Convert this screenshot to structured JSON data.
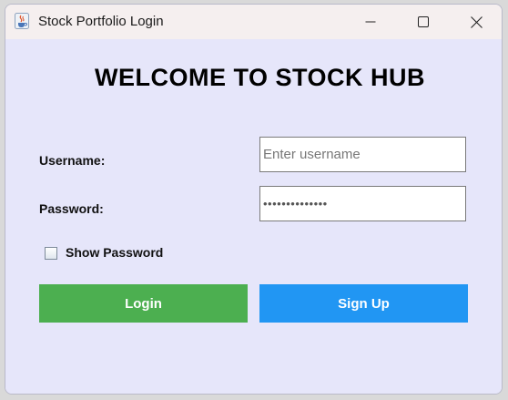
{
  "window": {
    "title": "Stock Portfolio Login",
    "icon": "java-cup-icon",
    "controls": [
      "minimize-icon",
      "maximize-icon",
      "close-icon"
    ]
  },
  "heading": "WELCOME TO STOCK HUB",
  "form": {
    "username_label": "Username:",
    "username_placeholder": "Enter username",
    "username_value": "",
    "password_label": "Password:",
    "password_value": "••••••••••••••",
    "show_password_label": "Show Password",
    "show_password_checked": false
  },
  "buttons": {
    "login": "Login",
    "signup": "Sign Up"
  },
  "colors": {
    "background": "#e6e6fa",
    "login_button": "#4caf50",
    "signup_button": "#2196f3"
  }
}
